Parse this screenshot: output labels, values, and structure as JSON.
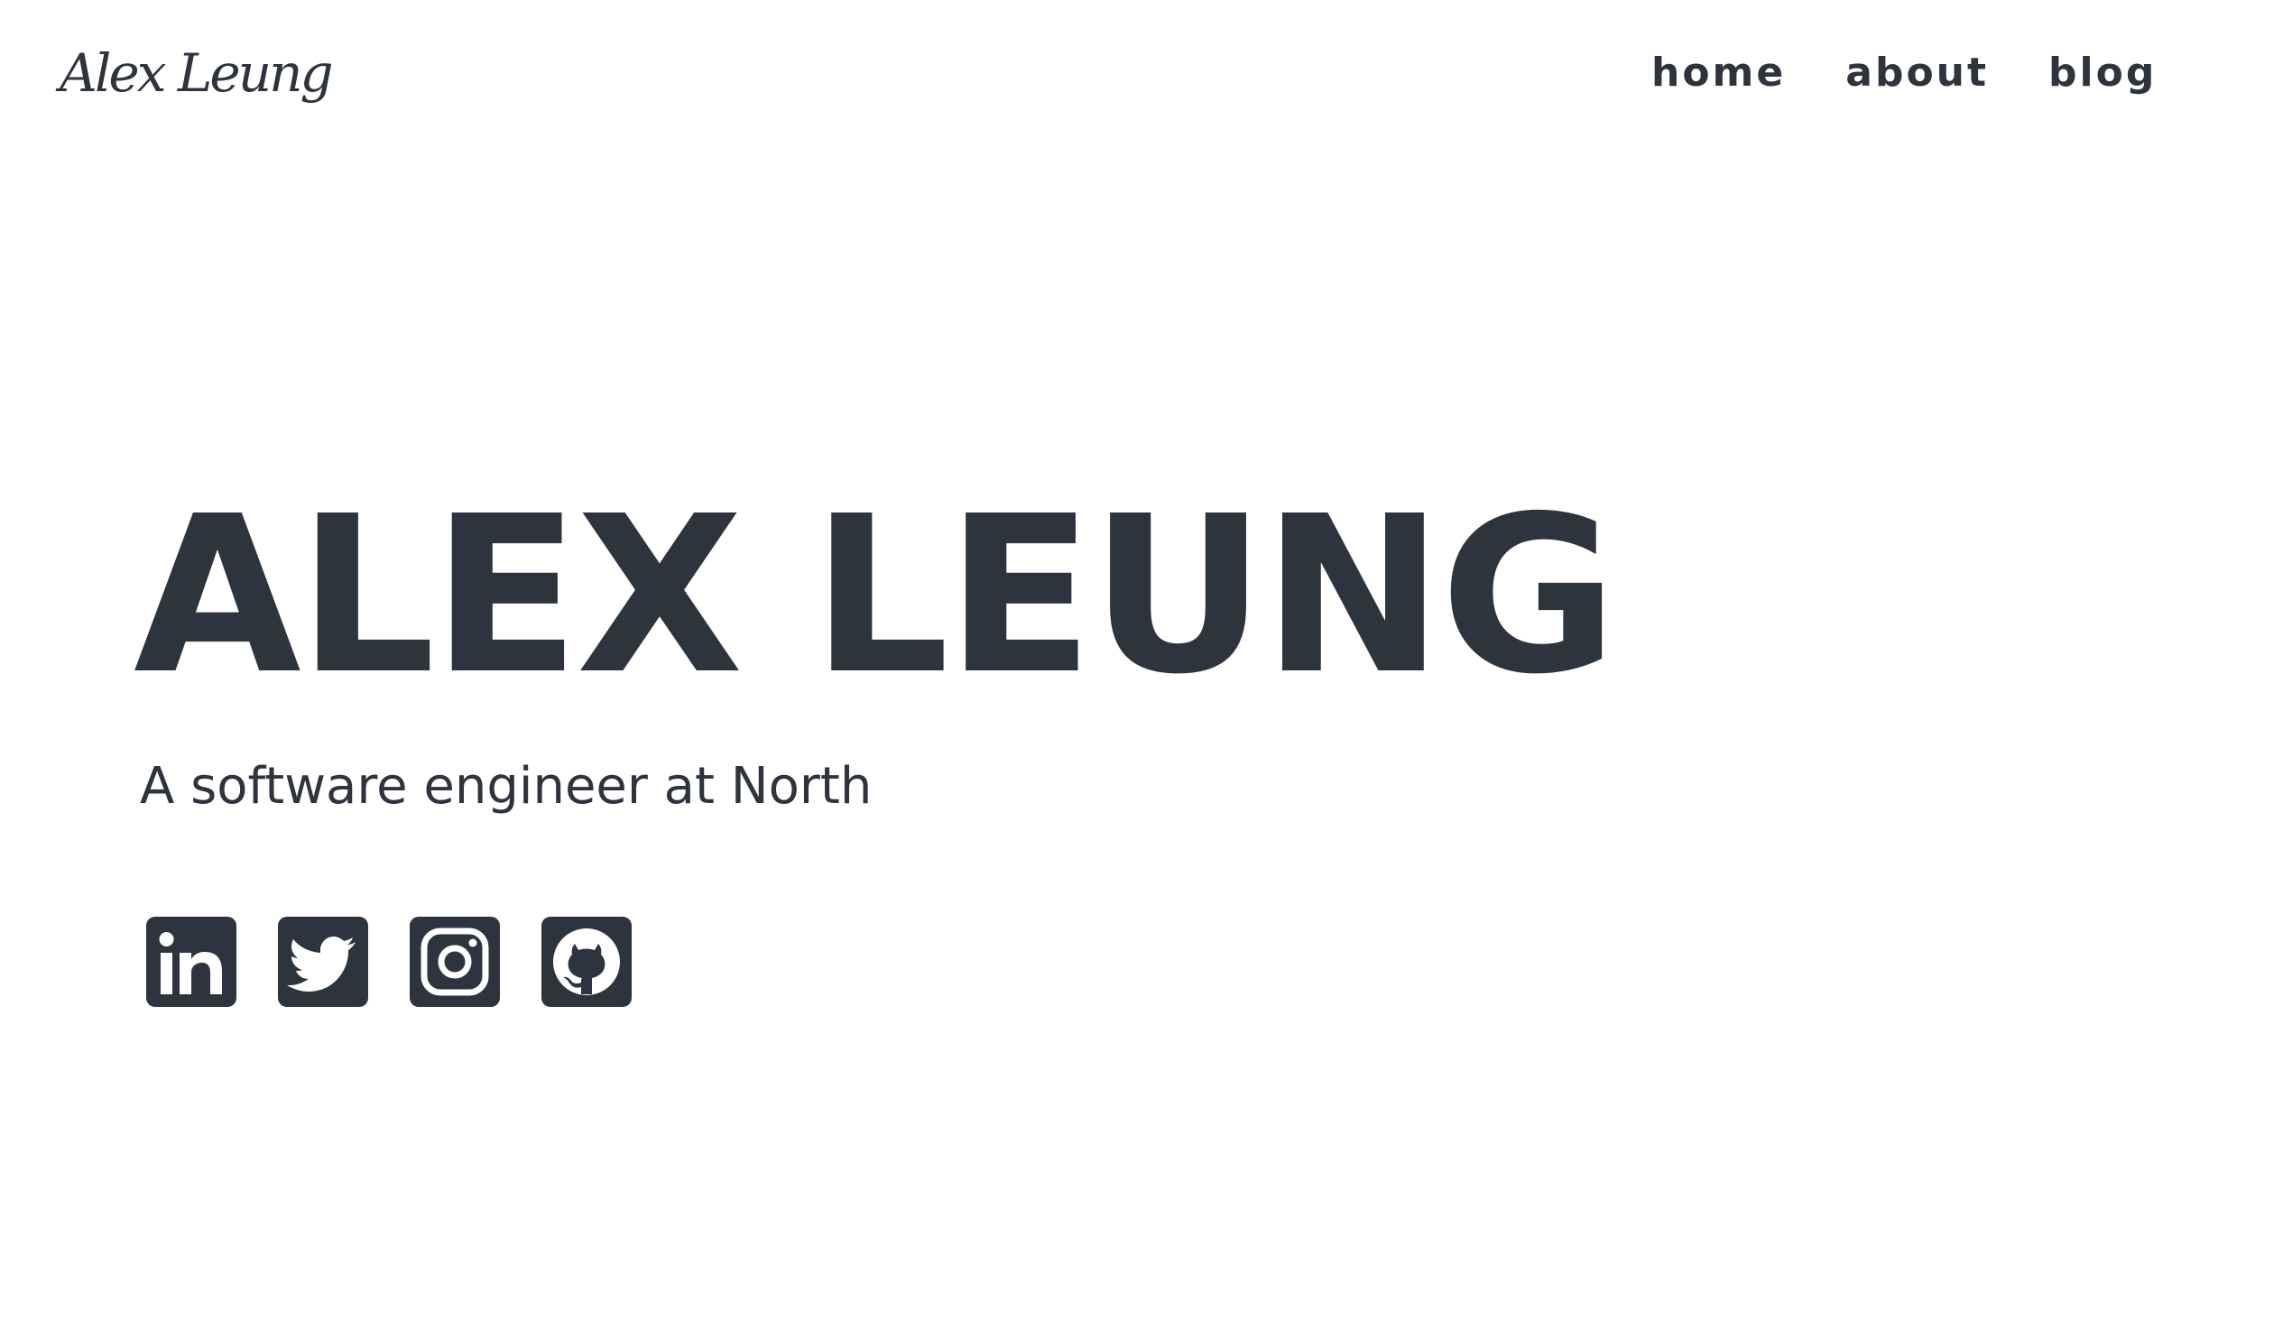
{
  "header": {
    "logo_text": "Alex Leung",
    "nav": [
      {
        "label": "home"
      },
      {
        "label": "about"
      },
      {
        "label": "blog"
      }
    ]
  },
  "hero": {
    "title": "ALEX LEUNG",
    "subtitle": "A software engineer at North"
  },
  "socials": [
    {
      "icon": "linkedin-icon"
    },
    {
      "icon": "twitter-icon"
    },
    {
      "icon": "instagram-icon"
    },
    {
      "icon": "github-icon"
    }
  ],
  "colors": {
    "text": "#2e343e",
    "background": "#ffffff"
  }
}
